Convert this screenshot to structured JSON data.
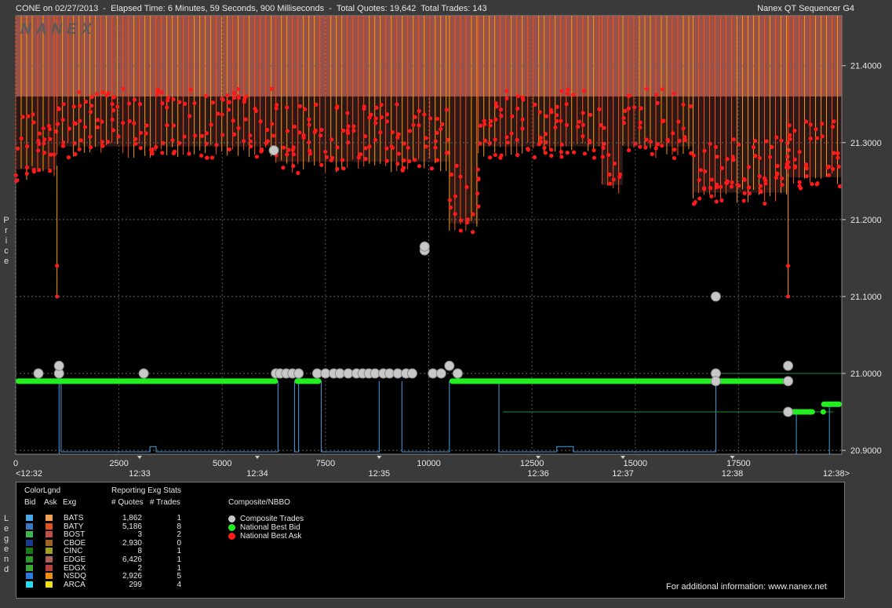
{
  "header": {
    "left": "CONE on 02/27/2013  -  Elapsed Time: 6 Minutes, 59 Seconds, 900 Milliseconds  -  Total Quotes: 19,642  Total Trades: 143",
    "right": "Nanex QT Sequencer G4"
  },
  "watermark": "NANEX",
  "side_labels": {
    "price": [
      "P",
      "r",
      "i",
      "c",
      "e"
    ],
    "legend": [
      "L",
      "e",
      "g",
      "e",
      "n",
      "d"
    ]
  },
  "colors": {
    "background": "#000000",
    "frame": "#3a3a3a",
    "ask": "#ff1a1a",
    "ask_line": "#ff9900",
    "ask_fill": "#b06058",
    "bid": "#22ee22",
    "bid_line": "#4a9fe0",
    "trade": "#c8c8c8"
  },
  "chart_data": {
    "type": "scatter",
    "x_ticks": [
      "0",
      "2500",
      "5000",
      "7500",
      "10000",
      "12500",
      "15000",
      "17500"
    ],
    "x_tick_values": [
      0,
      2500,
      5000,
      7500,
      10000,
      12500,
      15000,
      17500
    ],
    "time_ticks": [
      "<12:32",
      "12:33",
      "12:34",
      "12:35",
      "12:36",
      "12:37",
      "12:38",
      "12:38>"
    ],
    "time_tick_values": [
      0,
      3000,
      5850,
      8800,
      12650,
      14700,
      17350,
      20000
    ],
    "y_ticks": [
      "21.4000",
      "21.3000",
      "21.2000",
      "21.1000",
      "21.0000",
      "20.9000"
    ],
    "y_tick_values": [
      21.4,
      21.3,
      21.2,
      21.1,
      21.0,
      20.9
    ],
    "xlim": [
      0,
      20000
    ],
    "ylim": [
      20.895,
      21.465
    ],
    "ylabel": "Price",
    "grid": true,
    "series": [
      {
        "name": "National Best Bid",
        "segments": [
          {
            "x0": 0,
            "x1": 6350,
            "y": 20.99
          },
          {
            "x0": 6750,
            "x1": 7400,
            "y": 20.99
          },
          {
            "x0": 10500,
            "x1": 18700,
            "y": 20.99
          },
          {
            "x0": 18700,
            "x1": 19350,
            "y": 20.95
          },
          {
            "x0": 19500,
            "x1": 20000,
            "y": 20.96
          }
        ]
      },
      {
        "name": "National Best Ask",
        "segments": [
          {
            "x0": 0,
            "x1": 1000,
            "y": 21.27
          },
          {
            "x0": 1000,
            "x1": 6300,
            "y": 21.3
          },
          {
            "x0": 6300,
            "x1": 10500,
            "y": 21.28
          },
          {
            "x0": 10500,
            "x1": 11200,
            "y": 21.2
          },
          {
            "x0": 11200,
            "x1": 14200,
            "y": 21.3
          },
          {
            "x0": 14200,
            "x1": 14700,
            "y": 21.25
          },
          {
            "x0": 14700,
            "x1": 16400,
            "y": 21.3
          },
          {
            "x0": 16400,
            "x1": 18700,
            "y": 21.24
          },
          {
            "x0": 18700,
            "x1": 20000,
            "y": 21.26
          }
        ]
      },
      {
        "name": "Composite Trades",
        "points": [
          [
            550,
            21.0
          ],
          [
            1050,
            21.0
          ],
          [
            1050,
            21.01
          ],
          [
            3100,
            21.0
          ],
          [
            6250,
            21.29
          ],
          [
            6300,
            21.0
          ],
          [
            6400,
            21.0
          ],
          [
            6550,
            21.0
          ],
          [
            6700,
            21.0
          ],
          [
            6850,
            21.0
          ],
          [
            7300,
            21.0
          ],
          [
            7500,
            21.0
          ],
          [
            7700,
            21.0
          ],
          [
            7850,
            21.0
          ],
          [
            8050,
            21.0
          ],
          [
            8250,
            21.0
          ],
          [
            8400,
            21.0
          ],
          [
            8550,
            21.0
          ],
          [
            8700,
            21.0
          ],
          [
            8900,
            21.0
          ],
          [
            9050,
            21.0
          ],
          [
            9250,
            21.0
          ],
          [
            9450,
            21.0
          ],
          [
            9600,
            21.0
          ],
          [
            9900,
            21.16
          ],
          [
            9900,
            21.165
          ],
          [
            10100,
            21.0
          ],
          [
            10300,
            21.0
          ],
          [
            10500,
            21.01
          ],
          [
            10700,
            21.0
          ],
          [
            16950,
            21.1
          ],
          [
            16950,
            21.0
          ],
          [
            16950,
            20.99
          ],
          [
            18700,
            21.01
          ],
          [
            18700,
            20.99
          ],
          [
            18700,
            20.95
          ]
        ]
      }
    ]
  },
  "legend": {
    "col_headers": {
      "colorlgnd": "ColorLgnd",
      "bid": "Bid",
      "ask": "Ask",
      "exg": "Exg",
      "stats": "Reporting Exg Stats",
      "quotes": "# Quotes",
      "trades": "# Trades",
      "composite": "Composite/NBBO"
    },
    "rows": [
      {
        "exg": "BATS",
        "quotes": "1,862",
        "trades": "1",
        "bid_color": "#4aa8e8",
        "ask_color": "#f0a050"
      },
      {
        "exg": "BATY",
        "quotes": "5,186",
        "trades": "8",
        "bid_color": "#3a78c8",
        "ask_color": "#e85020"
      },
      {
        "exg": "BOST",
        "quotes": "3",
        "trades": "2",
        "bid_color": "#3ab850",
        "ask_color": "#c05048"
      },
      {
        "exg": "CBOE",
        "quotes": "2,930",
        "trades": "0",
        "bid_color": "#1a3a90",
        "ask_color": "#a06020"
      },
      {
        "exg": "CINC",
        "quotes": "8",
        "trades": "1",
        "bid_color": "#1a7a1a",
        "ask_color": "#a0a020"
      },
      {
        "exg": "EDGE",
        "quotes": "6,426",
        "trades": "1",
        "bid_color": "#2a9a2a",
        "ask_color": "#b06058"
      },
      {
        "exg": "EDGX",
        "quotes": "2",
        "trades": "1",
        "bid_color": "#38a838",
        "ask_color": "#b84040"
      },
      {
        "exg": "NSDQ",
        "quotes": "2,926",
        "trades": "5",
        "bid_color": "#2a7ae0",
        "ask_color": "#f09010"
      },
      {
        "exg": "ARCA",
        "quotes": "299",
        "trades": "4",
        "bid_color": "#20e0f0",
        "ask_color": "#f0e010"
      }
    ],
    "composite": [
      {
        "label": "Composite Trades",
        "color": "#c8c8c8"
      },
      {
        "label": "National Best Bid",
        "color": "#22ee22"
      },
      {
        "label": "National Best Ask",
        "color": "#ff1a1a"
      }
    ],
    "footer": "For additional information: www.nanex.net"
  }
}
